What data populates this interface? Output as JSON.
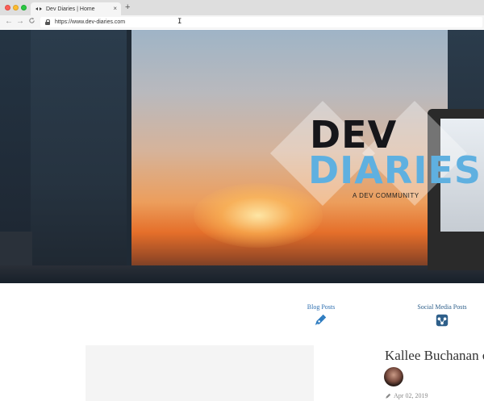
{
  "browser": {
    "tab_title": "Dev Diaries | Home",
    "tab_close_glyph": "×",
    "new_tab_glyph": "+",
    "url": "https://www.dev-diaries.com",
    "back_glyph": "←",
    "forward_glyph": "→",
    "reload_glyph": "C"
  },
  "hero": {
    "logo_line1": "DEV",
    "logo_line2": "DIARIES",
    "tagline": "A DEV COMMUNITY"
  },
  "nav": {
    "blog_label": "Blog Posts",
    "social_label": "Social Media Posts",
    "blog_icon": "pen-icon",
    "social_icon": "share-icon"
  },
  "post": {
    "title": "Kallee Buchanan on",
    "date": "Apr 02, 2019",
    "date_icon": "pen-icon"
  },
  "colors": {
    "brand_blue": "#5fb0e0",
    "link_blue": "#2e6fb0",
    "logo_dark": "#16161a"
  }
}
